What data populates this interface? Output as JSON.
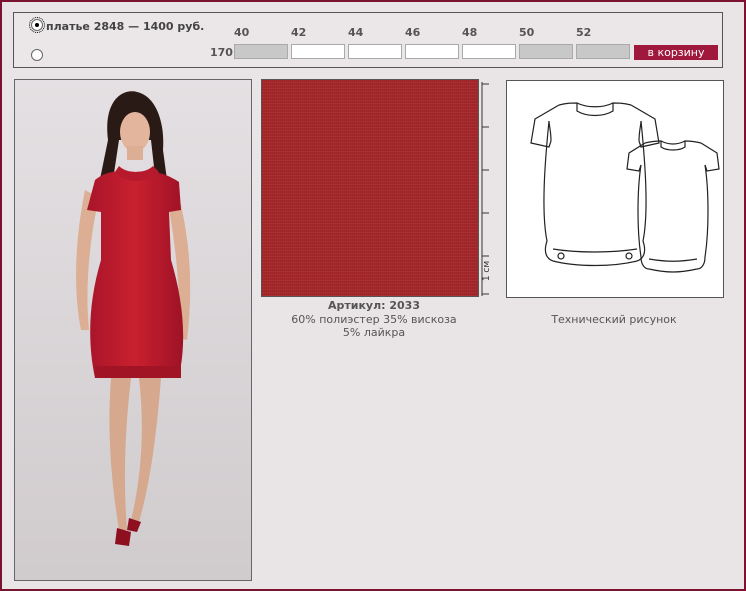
{
  "product": {
    "label": "платье  2848 — 1400 руб.",
    "article_label": "Артикул: 2033",
    "composition_line1": "60% полиэстер 35% вискоза",
    "composition_line2": "5% лайкра",
    "fabric_scale": "1 см",
    "tech_caption": "Технический рисунок",
    "fabric_color": "#a5272a"
  },
  "sizes": {
    "height": "170",
    "headers": [
      "40",
      "42",
      "44",
      "46",
      "48",
      "50",
      "52"
    ],
    "availability": [
      "unavailable",
      "available",
      "available",
      "available",
      "available",
      "unavailable",
      "unavailable"
    ]
  },
  "cart": {
    "label": "в корзину",
    "color": "#a0193c"
  },
  "options": {
    "selected_index": 0
  }
}
